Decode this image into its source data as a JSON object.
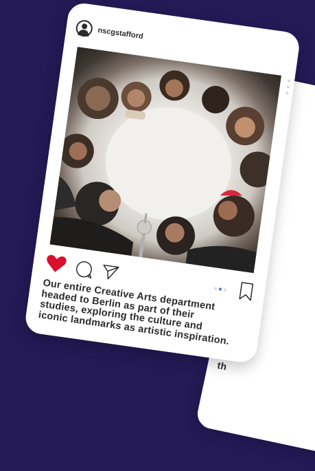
{
  "post": {
    "username": "nscgstafford",
    "caption": "Our entire Creative Arts department\nheaded to Berlin as part of their\nstudies, exploring the culture and\niconic landmarks as artistic inspiration.",
    "liked": true,
    "carousel_pages": 3,
    "carousel_current": 2
  },
  "back_post": {
    "caption": "N\nar\nth"
  },
  "colors": {
    "background": "#231a56",
    "heart": "#d9102b",
    "carousel_active": "#2f7be5"
  },
  "icons": [
    "avatar-icon",
    "more-icon",
    "heart-icon",
    "comment-icon",
    "share-icon",
    "save-icon"
  ]
}
